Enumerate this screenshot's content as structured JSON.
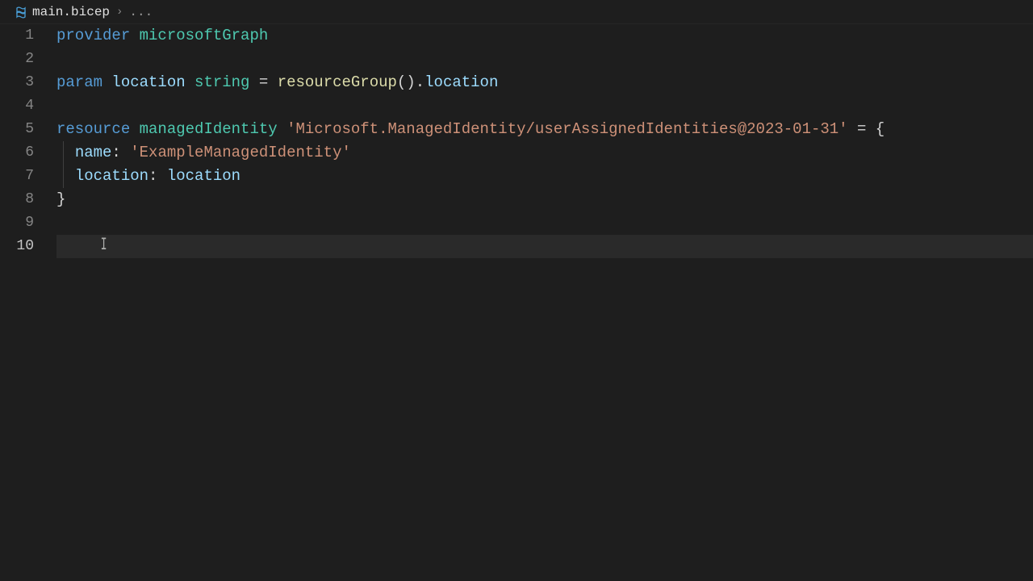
{
  "tab": {
    "filename": "main.bicep",
    "breadcrumb_dots": "..."
  },
  "gutter": {
    "l1": "1",
    "l2": "2",
    "l3": "3",
    "l4": "4",
    "l5": "5",
    "l6": "6",
    "l7": "7",
    "l8": "8",
    "l9": "9",
    "l10": "10"
  },
  "code": {
    "line1": {
      "k1": "provider",
      "sp": " ",
      "name": "microsoftGraph"
    },
    "line3": {
      "k1": "param",
      "sp": " ",
      "var": "location",
      "sp2": " ",
      "type": "string",
      "sp3": " ",
      "eq": "=",
      "sp4": " ",
      "func": "resourceGroup",
      "paren": "()",
      "dot": ".",
      "prop": "location"
    },
    "line5": {
      "k1": "resource",
      "sp": " ",
      "name": "managedIdentity",
      "sp2": " ",
      "str": "'Microsoft.ManagedIdentity/userAssignedIdentities@2023-01-31'",
      "sp3": " ",
      "eq": "=",
      "sp4": " ",
      "brace": "{"
    },
    "line6": {
      "indent": "  ",
      "prop": "name",
      "colon": ":",
      "sp": " ",
      "str": "'ExampleManagedIdentity'"
    },
    "line7": {
      "indent": "  ",
      "prop": "location",
      "colon": ":",
      "sp": " ",
      "val": "location"
    },
    "line8": {
      "brace": "}"
    }
  }
}
